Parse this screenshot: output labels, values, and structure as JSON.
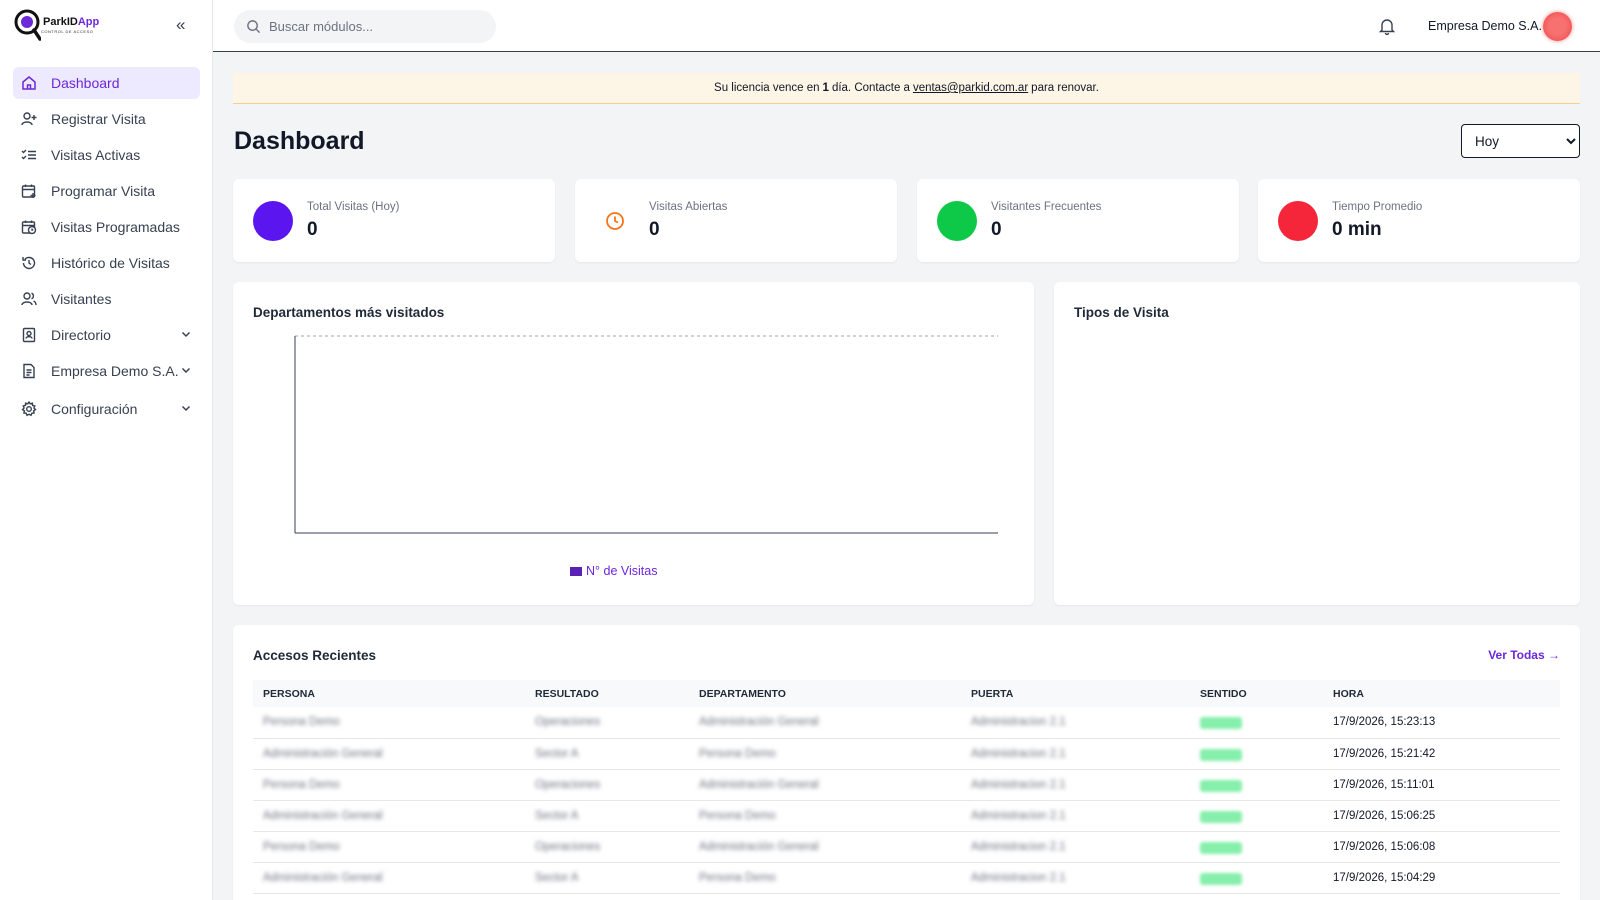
{
  "app": {
    "logo_name_a": "ParkID",
    "logo_name_b": "App",
    "logo_subtitle": "CONTROL DE ACCESO"
  },
  "sidebar": {
    "items": [
      {
        "label": "Dashboard",
        "icon": "home-icon",
        "active": true
      },
      {
        "label": "Registrar Visita",
        "icon": "user-plus-icon"
      },
      {
        "label": "Visitas Activas",
        "icon": "list-check-icon"
      },
      {
        "label": "Programar Visita",
        "icon": "calendar-plus-icon"
      },
      {
        "label": "Visitas Programadas",
        "icon": "calendar-clock-icon"
      },
      {
        "label": "Histórico de Visitas",
        "icon": "history-icon"
      },
      {
        "label": "Visitantes",
        "icon": "users-icon"
      },
      {
        "label": "Directorio",
        "icon": "contact-book-icon",
        "expandable": true
      },
      {
        "label": "Empresa Demo S.A.",
        "icon": "document-icon",
        "expandable": true
      },
      {
        "label": "Configuración",
        "icon": "gear-icon",
        "expandable": true
      }
    ]
  },
  "topbar": {
    "search_placeholder": "Buscar módulos...",
    "company": "Empresa Demo S.A."
  },
  "banner": {
    "prefix": "Su licencia vence en",
    "days": "1",
    "middle": "día. Contacte a",
    "email": "ventas@parkid.com.ar",
    "suffix": "para renovar."
  },
  "page": {
    "title": "Dashboard",
    "period_selected": "Hoy"
  },
  "stats": [
    {
      "label": "Total Visitas (Hoy)",
      "value": "0",
      "color": "#5b16f0"
    },
    {
      "label": "Visitas Abiertas",
      "value": "0",
      "color": "#f97316"
    },
    {
      "label": "Visitantes Frecuentes",
      "value": "0",
      "color": "#0ec948"
    },
    {
      "label": "Tiempo Promedio",
      "value": "0 min",
      "color": "#f5253a"
    }
  ],
  "charts": {
    "departments_title": "Departamentos más visitados",
    "legend_label": "N° de Visitas",
    "types_title": "Tipos de Visita"
  },
  "chart_data": {
    "type": "bar",
    "categories": [],
    "series": [
      {
        "name": "N° de Visitas",
        "values": []
      }
    ],
    "title": "Departamentos más visitados",
    "grid": true
  },
  "recent": {
    "title": "Accesos Recientes",
    "view_all": "Ver Todas →",
    "columns": [
      "Persona",
      "Resultado",
      "Departamento",
      "Puerta",
      "Sentido",
      "Hora"
    ],
    "rows": [
      {
        "persona": "Persona Demo",
        "resultado": "Operaciones",
        "departamento": "Administración General",
        "puerta": "Administracion 2.1",
        "sentido": "Entrada",
        "hora": "17/9/2026, 15:23:13"
      },
      {
        "persona": "Administración General",
        "resultado": "Sector A",
        "departamento": "Persona Demo",
        "puerta": "Administracion 2.1",
        "sentido": "Entrada",
        "hora": "17/9/2026, 15:21:42"
      },
      {
        "persona": "Persona Demo",
        "resultado": "Operaciones",
        "departamento": "Administración General",
        "puerta": "Administracion 2.1",
        "sentido": "Entrada",
        "hora": "17/9/2026, 15:11:01"
      },
      {
        "persona": "Administración General",
        "resultado": "Sector A",
        "departamento": "Persona Demo",
        "puerta": "Administracion 2.1",
        "sentido": "Entrada",
        "hora": "17/9/2026, 15:06:25"
      },
      {
        "persona": "Persona Demo",
        "resultado": "Operaciones",
        "departamento": "Administración General",
        "puerta": "Administracion 2.1",
        "sentido": "Entrada",
        "hora": "17/9/2026, 15:06:08"
      },
      {
        "persona": "Administración General",
        "resultado": "Sector A",
        "departamento": "Persona Demo",
        "puerta": "Administracion 2.1",
        "sentido": "Entrada",
        "hora": "17/9/2026, 15:04:29"
      }
    ]
  }
}
